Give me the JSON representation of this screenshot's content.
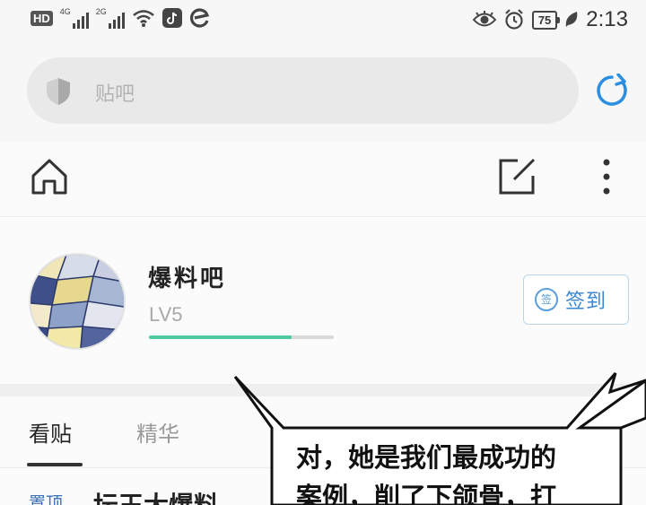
{
  "status_bar": {
    "hd_label": "HD",
    "network_1": "4G",
    "network_2": "2G",
    "battery": "75",
    "time": "2:13"
  },
  "search": {
    "placeholder": "贴吧"
  },
  "forum": {
    "name": "爆料吧",
    "level": "LV5",
    "level_progress": 0.77,
    "signin_badge": "签",
    "signin_label": "签到"
  },
  "tabs": [
    {
      "label": "看贴",
      "active": true
    },
    {
      "label": "精华",
      "active": false
    }
  ],
  "posts": [
    {
      "badge": "置顶",
      "title": "坛王大爆料"
    }
  ],
  "comic_bubble": {
    "lines": [
      "对，她是我们最成功的",
      "案例，削了下颌骨，打"
    ]
  },
  "colors": {
    "accent_blue": "#3b86d3",
    "level_green": "#4dc8a0",
    "refresh_blue": "#2a8fe0"
  },
  "icons": [
    "eye-icon",
    "alarm-icon",
    "leaf-icon",
    "tiktok-icon",
    "browser-icon",
    "shield-icon",
    "refresh-icon",
    "home-icon",
    "edit-icon",
    "more-icon"
  ]
}
